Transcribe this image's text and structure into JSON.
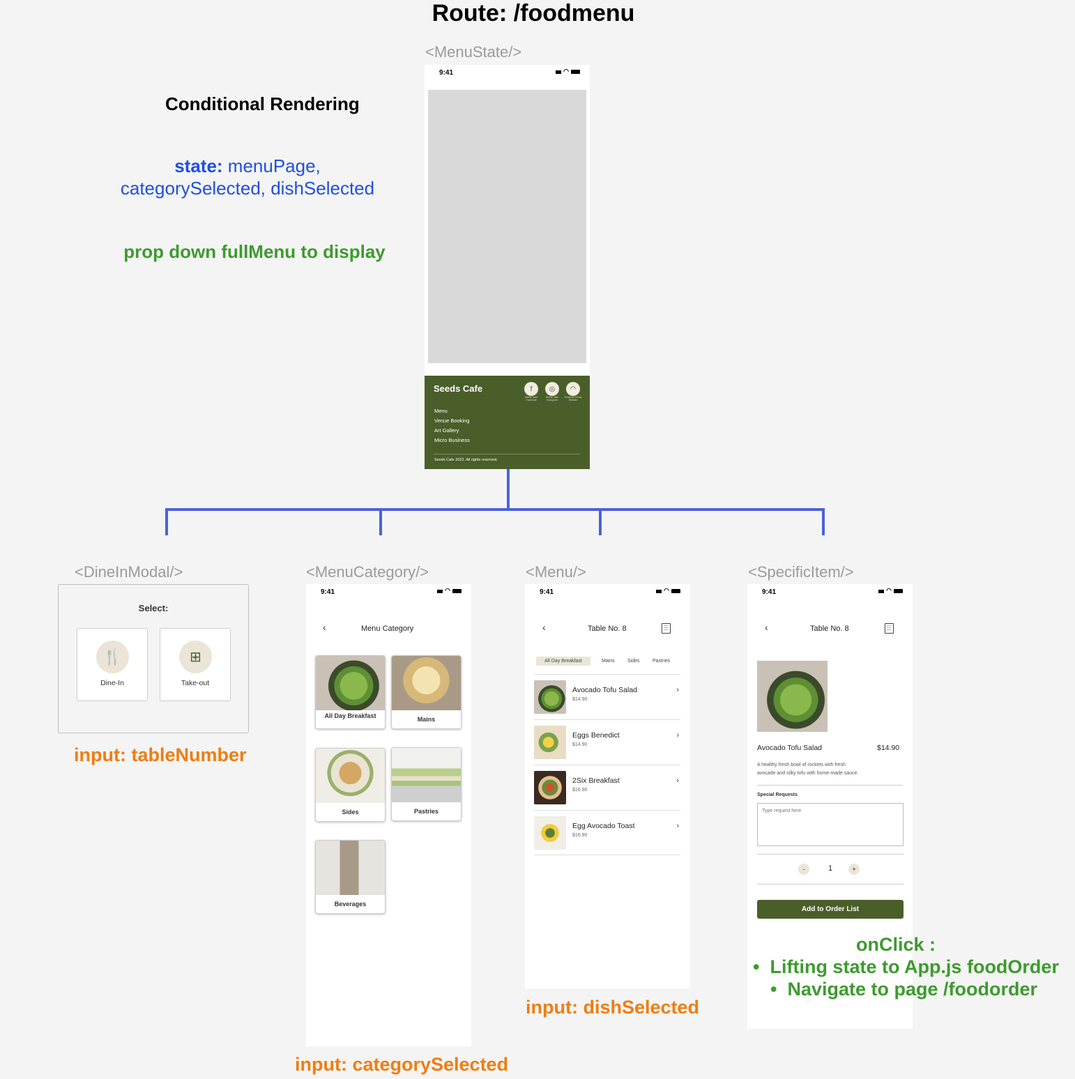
{
  "route_title": "Route: /foodmenu",
  "labels": {
    "menu_state": "<MenuState/>",
    "dine_in_modal": "<DineInModal/>",
    "menu_category": "<MenuCategory/>",
    "menu": "<Menu/>",
    "specific_item": "<SpecificItem/>"
  },
  "notes": {
    "conditional": "Conditional Rendering",
    "state_prefix": "state:",
    "state_line1": " menuPage,",
    "state_line2": "categorySelected, dishSelected",
    "prop": "prop down fullMenu to display",
    "input_table": "input: tableNumber",
    "input_category": "input: categorySelected",
    "input_dish": "input: dishSelected",
    "onclick_title": "onClick :",
    "onclick_items": [
      "Lifting state to App.js foodOrder",
      "Navigate to page /foodorder"
    ]
  },
  "status": {
    "time": "9:41"
  },
  "footer": {
    "brand": "Seeds Cafe",
    "links": [
      "Menu",
      "Venue Booking",
      "Art Gallery",
      "Micro Business"
    ],
    "social": [
      "Seeds Cafe Facebook",
      "Seeds Cafe Instagram",
      "Sunshine Home Website"
    ],
    "copyright": "Seeds Cafe 2022. All rights reserved."
  },
  "modal": {
    "title": "Select:",
    "options": [
      "Dine-In",
      "Take-out"
    ]
  },
  "category_screen": {
    "title": "Menu Category",
    "categories": [
      "All Day Breakfast",
      "Mains",
      "Sides",
      "Pastries",
      "Beverages"
    ]
  },
  "menu_screen": {
    "title": "Table No. 8",
    "tabs": [
      "All Day Breakfast",
      "Mains",
      "Sides",
      "Pastries"
    ],
    "items": [
      {
        "name": "Avocado Tofu Salad",
        "price": "$14.90"
      },
      {
        "name": "Eggs Benedict",
        "price": "$14.90"
      },
      {
        "name": "2Six Breakfast",
        "price": "$16.90"
      },
      {
        "name": "Egg Avocado Toast",
        "price": "$16.90"
      }
    ]
  },
  "item_screen": {
    "title": "Table No. 8",
    "name": "Avocado Tofu Salad",
    "price": "$14.90",
    "desc1": "A healthy fresh bowl of rockets with fresh",
    "desc2": "avocade and silky tofu with home-made sauce.",
    "special_label": "Special Requests",
    "placeholder": "Type request here",
    "qty": "1",
    "minus": "-",
    "plus": "+",
    "add_button": "Add to Order List"
  },
  "colors": {
    "connector": "#4a63d8",
    "brand_green": "#4a5e2a",
    "note_blue": "#1f4fe0",
    "note_green": "#3d9b2e",
    "note_orange": "#f07d10"
  }
}
